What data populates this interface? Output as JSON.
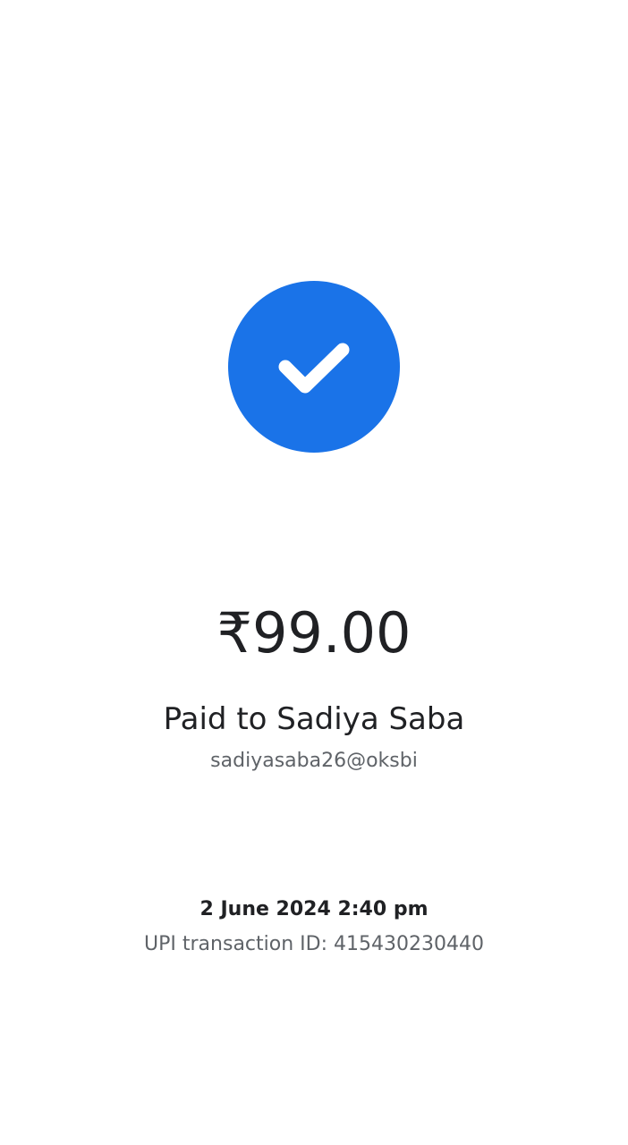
{
  "status": {
    "icon": "check-circle-icon",
    "accent_color": "#1a73e8"
  },
  "payment": {
    "amount": "₹99.00",
    "paid_to": "Paid to Sadiya Saba",
    "upi_id": "sadiyasaba26@oksbi",
    "datetime": "2 June 2024 2:40 pm",
    "transaction_id": "UPI transaction ID: 415430230440"
  }
}
